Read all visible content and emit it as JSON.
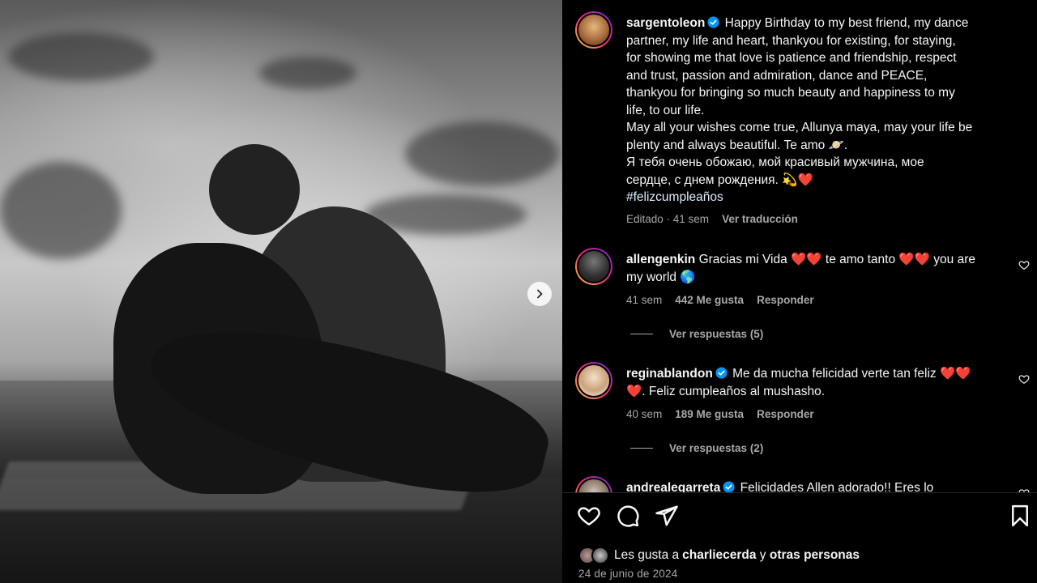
{
  "post": {
    "author": "sargentoleon",
    "caption_lines": [
      "Happy Birthday to my best friend, my dance",
      "partner, my life and heart, thankyou for existing, for staying,",
      "for showing me that love is patience and friendship, respect",
      "and trust, passion and admiration, dance and PEACE,",
      "thankyou for bringing so much beauty and happiness to my",
      "life, to our life.",
      "May all your wishes come true, Allunya maya, may your life be",
      "plenty and always beautiful. Te amo 🪐.",
      "Я тебя очень обожаю, мой красивый мужчина, мое",
      "сердце, с днем рождения. 💫❤️"
    ],
    "hashtag": "#felizcumpleaños",
    "edited_time": "Editado · 41 sem",
    "translate": "Ver traducción"
  },
  "comments": [
    {
      "user": "allengenkin",
      "text_line1": "Gracias mi Vida ❤️❤️ te amo tanto ❤️❤️ you are",
      "text_line2": "my world 🌎",
      "time": "41 sem",
      "likes": "442 Me gusta",
      "reply": "Responder",
      "view_replies": "Ver respuestas (5)"
    },
    {
      "user": "reginablandon",
      "text_line1": "Me da mucha felicidad verte tan feliz ❤️❤️",
      "text_line2": "❤️. Feliz cumpleaños al mushasho.",
      "time": "40 sem",
      "likes": "189 Me gusta",
      "reply": "Responder",
      "view_replies": "Ver respuestas (2)"
    },
    {
      "user": "andrealegarreta",
      "text_line1": "Felicidades Allen adorado!! Eres lo"
    }
  ],
  "likes_bar": {
    "prefix": "Les gusta a ",
    "user": "charliecerda",
    "middle": " y ",
    "others": "otras personas"
  },
  "date": "24 de junio de 2024",
  "colors": {
    "verified": "#0095f6",
    "muted": "#a8a8a8",
    "background": "#000000"
  },
  "icons": [
    "heart-icon",
    "comment-icon",
    "share-icon",
    "bookmark-icon",
    "chevron-right-icon",
    "verified-badge-icon"
  ]
}
